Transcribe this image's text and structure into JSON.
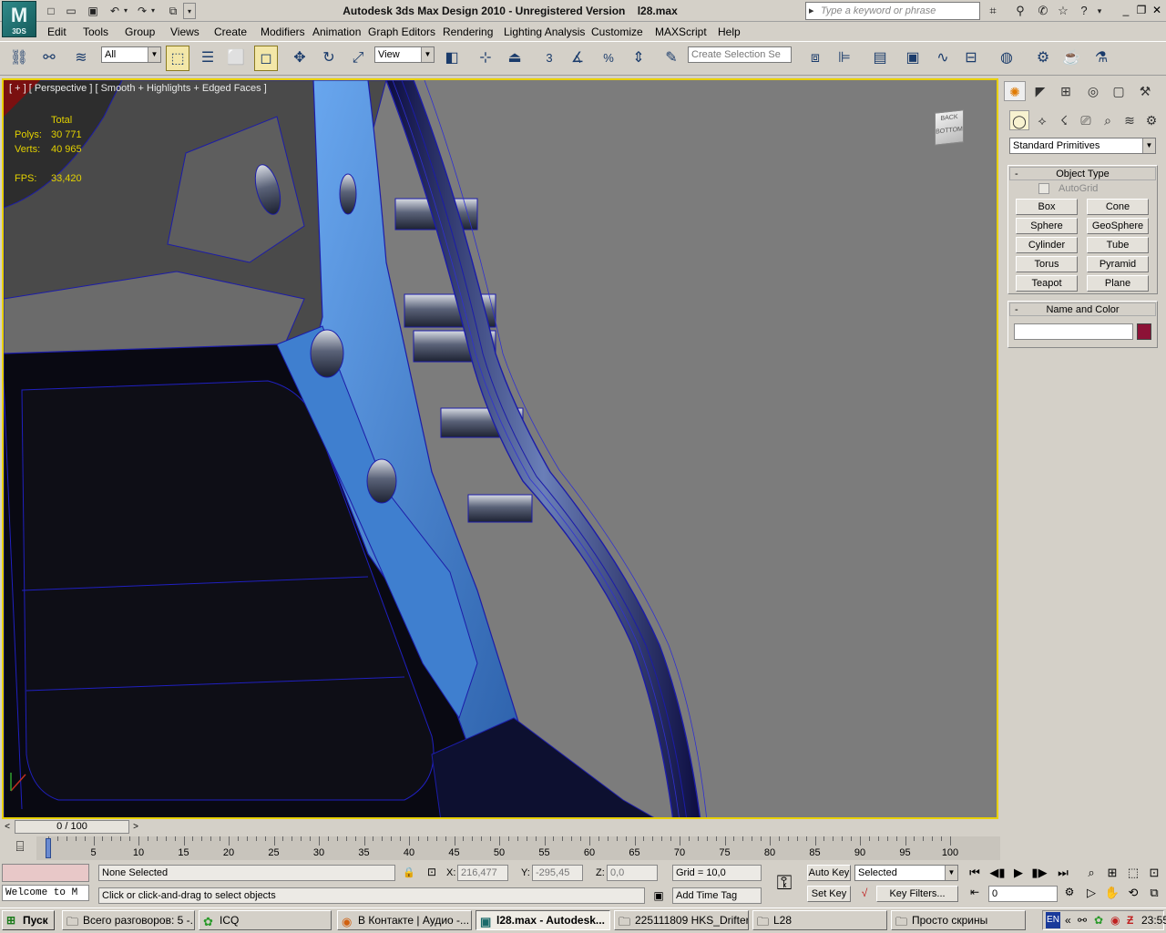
{
  "app": {
    "title": "Autodesk 3ds Max Design 2010  -  Unregistered Version",
    "file": "l28.max",
    "logo_text": "M",
    "logo_sub": "3DS",
    "search_placeholder": "Type a keyword or phrase"
  },
  "menus": [
    "Edit",
    "Tools",
    "Group",
    "Views",
    "Create",
    "Modifiers",
    "Animation",
    "Graph Editors",
    "Rendering",
    "Lighting Analysis",
    "Customize",
    "MAXScript",
    "Help"
  ],
  "toolbar": {
    "selection_filter": "All",
    "reference_coord": "View",
    "named_selection_placeholder": "Create Selection Se",
    "snap_label": "3",
    "percent_label": "%"
  },
  "viewport": {
    "label": "[ + ] [ Perspective ] [ Smooth + Highlights + Edged Faces ]",
    "stats": {
      "total_label": "Total",
      "polys_label": "Polys:",
      "polys_value": "30 771",
      "verts_label": "Verts:",
      "verts_value": "40 965",
      "fps_label": "FPS:",
      "fps_value": "33,420"
    },
    "viewcube_top": "BACK",
    "viewcube_bottom": "BOTTOM"
  },
  "command_panel": {
    "category": "Standard Primitives",
    "object_type_title": "Object Type",
    "autogrid_label": "AutoGrid",
    "buttons": [
      "Box",
      "Cone",
      "Sphere",
      "GeoSphere",
      "Cylinder",
      "Tube",
      "Torus",
      "Pyramid",
      "Teapot",
      "Plane"
    ],
    "name_color_title": "Name and Color",
    "object_name": "",
    "object_color": "#8c1236"
  },
  "timeline": {
    "frame_display": "0 / 100",
    "ticks": [
      "0",
      "5",
      "10",
      "15",
      "20",
      "25",
      "30",
      "35",
      "40",
      "45",
      "50",
      "55",
      "60",
      "65",
      "70",
      "75",
      "80",
      "85",
      "90",
      "95",
      "100"
    ]
  },
  "status": {
    "maxscript_listener": "Welcome to M",
    "selection_text": "None Selected",
    "prompt_text": "Click or click-and-drag to select objects",
    "x_label": "X:",
    "x_value": "216,477",
    "y_label": "Y:",
    "y_value": "-295,45",
    "z_label": "Z:",
    "z_value": "0,0",
    "grid_text": "Grid = 10,0",
    "add_time_tag": "Add Time Tag",
    "auto_key": "Auto Key",
    "set_key": "Set Key",
    "key_mode": "Selected",
    "key_filters": "Key Filters...",
    "current_frame": "0"
  },
  "taskbar": {
    "start_label": "Пуск",
    "tasks": [
      {
        "label": "Всего разговоров: 5 -...",
        "icon": "folder"
      },
      {
        "label": "ICQ",
        "icon": "flower"
      },
      {
        "label": "В Контакте | Аудио -...",
        "icon": "browser"
      },
      {
        "label": "l28.max - Autodesk...",
        "icon": "max"
      },
      {
        "label": "225111809 HKS_Drifter",
        "icon": "folder"
      },
      {
        "label": "L28",
        "icon": "folder"
      },
      {
        "label": "Просто скрины",
        "icon": "folder"
      }
    ],
    "lang": "EN",
    "clock": "23:55"
  },
  "colors": {
    "viewport_bg": "#7c7c7c",
    "active_border": "#e8d000",
    "stats_color": "#e2d100",
    "model_blue": "#3f7fcf",
    "wire_blue": "#1c1ca8"
  }
}
